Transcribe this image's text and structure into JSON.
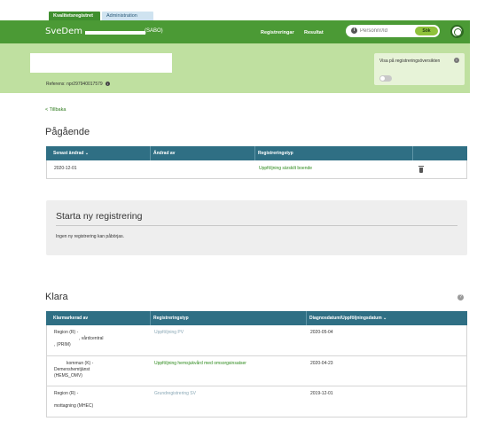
{
  "tabs": {
    "active": "Kvalitetsregistret",
    "inactive": "Administration"
  },
  "header": {
    "brand": "SveDem",
    "unit_suffix": "(SABO)",
    "nav": [
      "Registreringar",
      "Resultat"
    ],
    "search_placeholder": "Personnr/Id",
    "search_button": "Sök"
  },
  "banner": {
    "reference": "Referens: npr297940017579",
    "overview_label": "Visa på registreringsöversikten",
    "overview_enabled": false
  },
  "back_link": "< Tillbaka",
  "ongoing": {
    "title": "Pågående",
    "columns": [
      "Senast ändrad ⌄",
      "Ändrad av",
      "Registreringstyp",
      ""
    ],
    "rows": [
      {
        "date": "2020-12-01",
        "changed_by": "",
        "type": "Uppföljning särskilt boende"
      }
    ]
  },
  "start_new": {
    "title": "Starta ny registrering",
    "text": "Ingen ny registrering kan påbörjas."
  },
  "done": {
    "title": "Klara",
    "columns": [
      "Klarmarkerad av",
      "Registreringstyp",
      "Diagnosdatum/Uppföljningsdatum ⌄"
    ],
    "rows": [
      {
        "by_line1": "Region             (R) -",
        "by_line2": ", vårdcentral",
        "by_line3": ",               (PRIM)",
        "type": "Uppföljning PV",
        "date": "2020-05-04"
      },
      {
        "by_line1": "kommun (K) -",
        "by_line2": "Demenshemtjänst",
        "by_line3": "(HEMS_OMV)",
        "type": "Uppföljning hemsjukvård med omsorgsinsatser",
        "date": "2020-04-23"
      },
      {
        "by_line1": "Region             (R) -",
        "by_line2": "",
        "by_line3": "mottagning (MHEC)",
        "type": "Grundregistrering SV",
        "date": "2019-12-01"
      }
    ]
  }
}
